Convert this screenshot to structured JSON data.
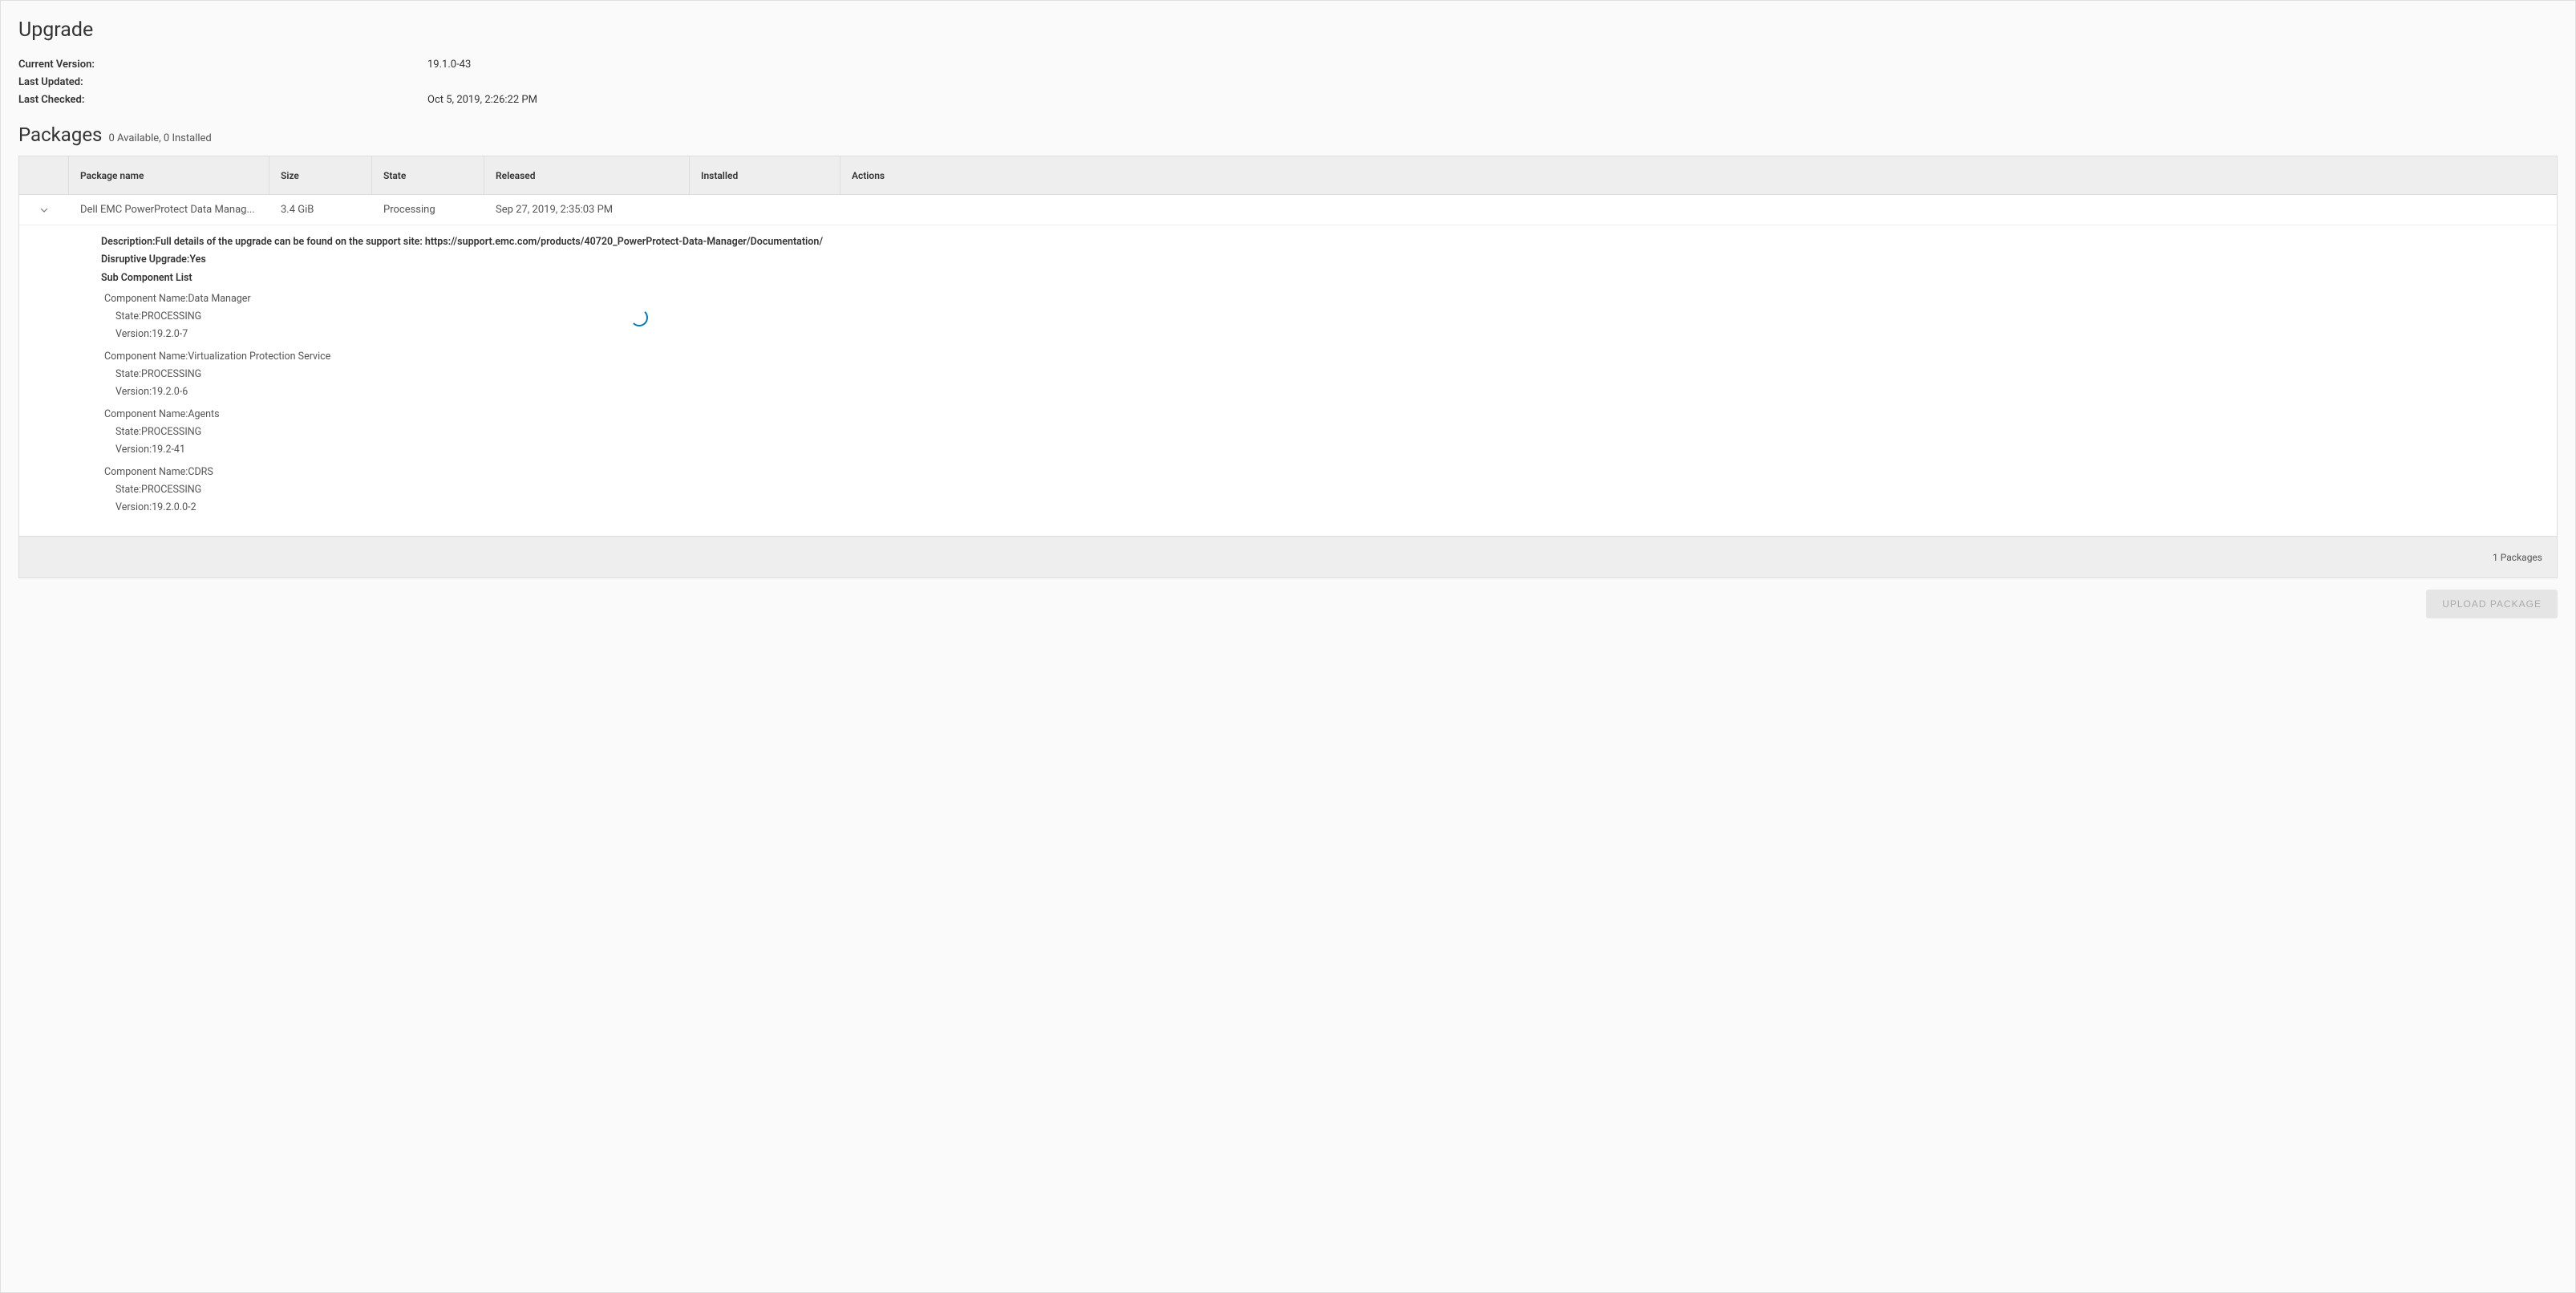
{
  "page": {
    "title": "Upgrade",
    "meta": {
      "currentVersionLabel": "Current Version:",
      "currentVersionValue": "19.1.0-43",
      "lastUpdatedLabel": "Last Updated:",
      "lastUpdatedValue": "",
      "lastCheckedLabel": "Last Checked:",
      "lastCheckedValue": "Oct 5, 2019, 2:26:22 PM"
    },
    "packagesSection": {
      "title": "Packages",
      "summary": "0 Available, 0 Installed"
    }
  },
  "grid": {
    "columns": {
      "name": "Package name",
      "size": "Size",
      "state": "State",
      "released": "Released",
      "installed": "Installed",
      "actions": "Actions"
    },
    "rows": [
      {
        "name": "Dell EMC PowerProtect Data Manag...",
        "size": "3.4 GiB",
        "state": "Processing",
        "released": "Sep 27, 2019, 2:35:03 PM",
        "installed": "",
        "actions": ""
      }
    ],
    "footer": "1 Packages"
  },
  "detail": {
    "descriptionLabel": "Description:",
    "descriptionValue": "Full details of the upgrade can be found on the support site: https://support.emc.com/products/40720_PowerProtect-Data-Manager/Documentation/",
    "disruptiveLabel": "Disruptive Upgrade:",
    "disruptiveValue": "Yes",
    "subListLabel": "Sub Component List",
    "componentNameLabel": "Component Name:",
    "stateLabel": "State:",
    "versionLabel": "Version:",
    "components": [
      {
        "name": "Data Manager",
        "state": "PROCESSING",
        "version": "19.2.0-7"
      },
      {
        "name": "Virtualization Protection Service",
        "state": "PROCESSING",
        "version": "19.2.0-6"
      },
      {
        "name": "Agents",
        "state": "PROCESSING",
        "version": "19.2-41"
      },
      {
        "name": "CDRS",
        "state": "PROCESSING",
        "version": "19.2.0.0-2"
      }
    ]
  },
  "buttons": {
    "upload": "UPLOAD PACKAGE"
  }
}
